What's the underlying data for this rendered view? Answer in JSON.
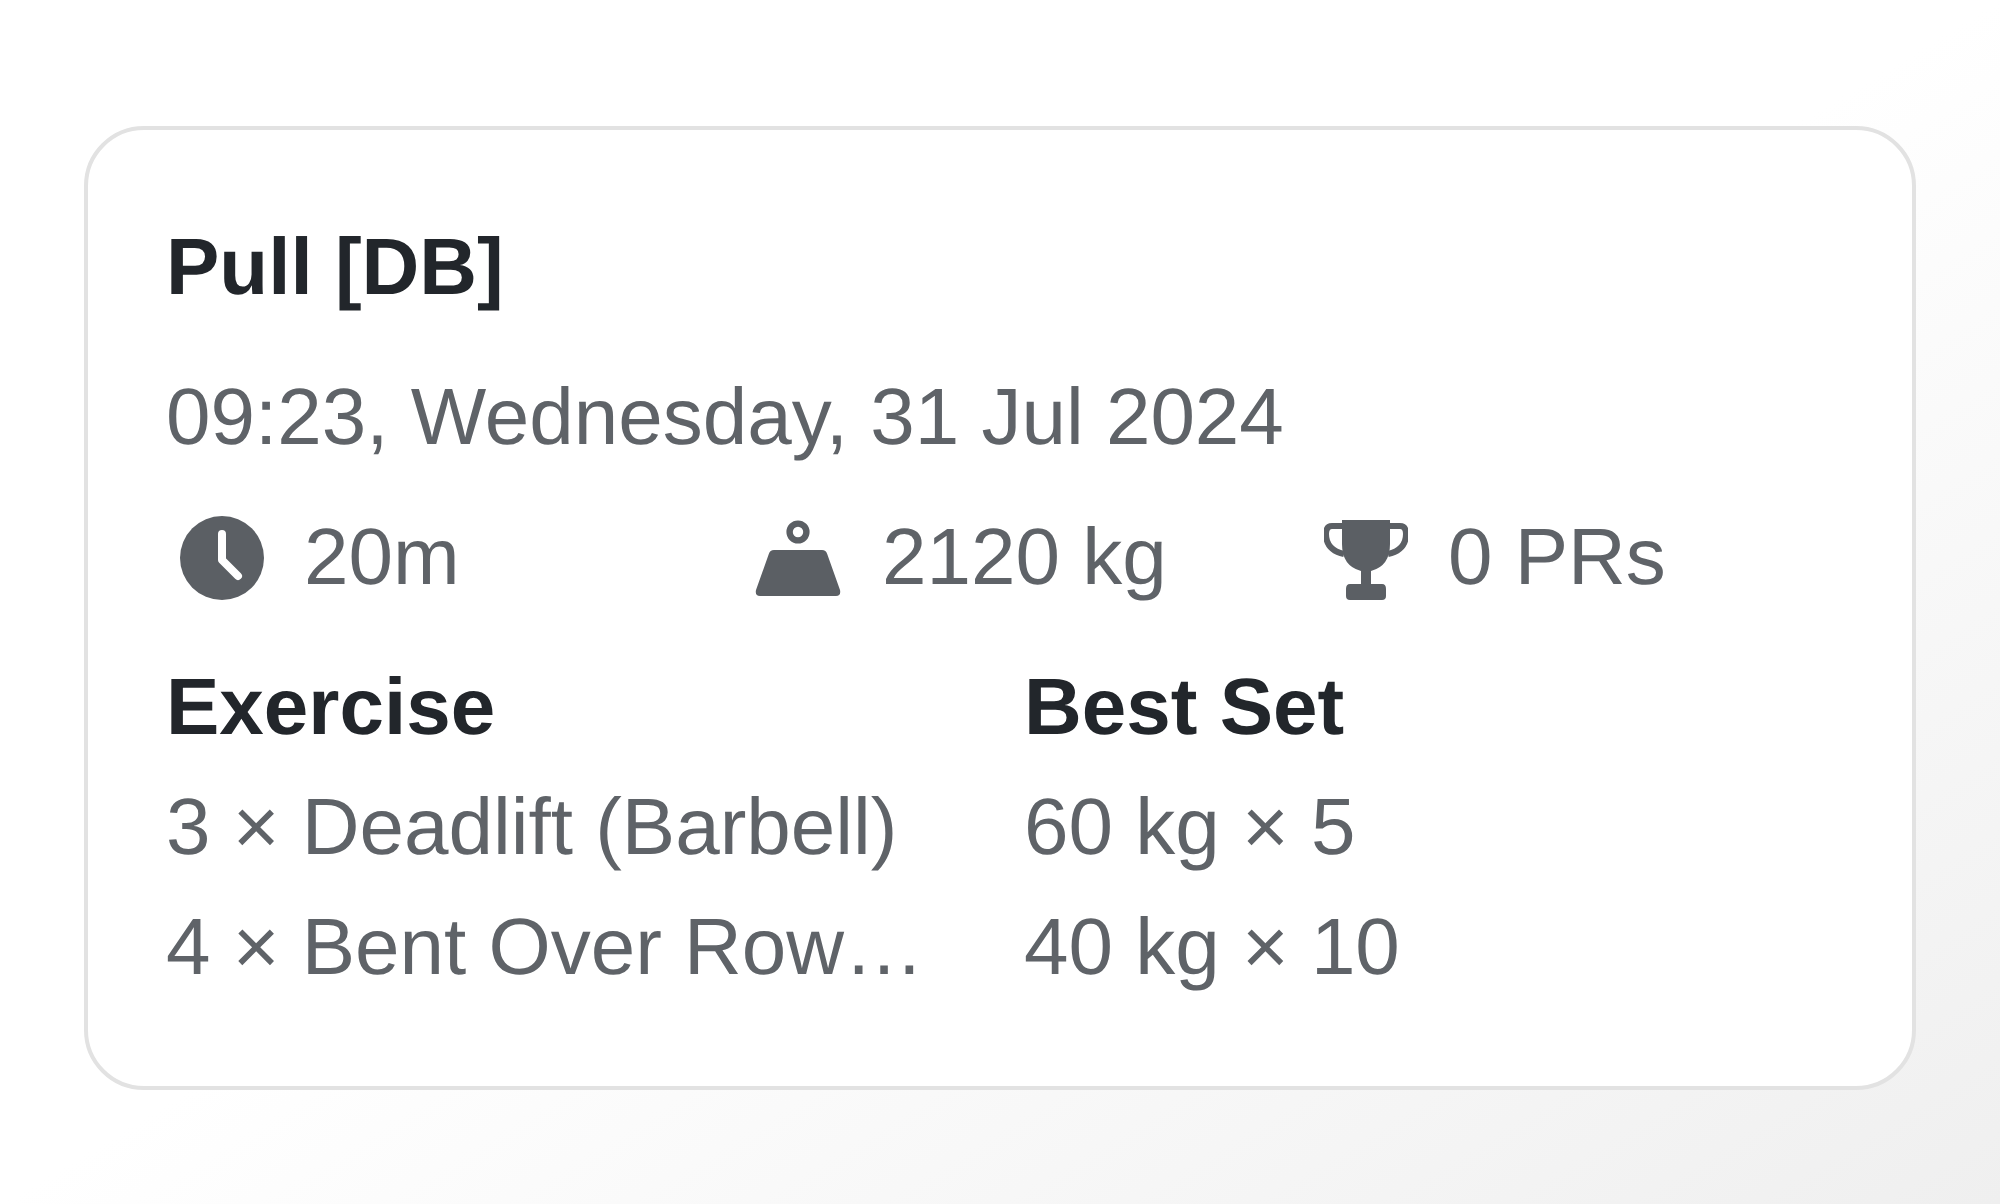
{
  "workout": {
    "title": "Pull [DB]",
    "datetime": "09:23, Wednesday, 31 Jul 2024",
    "stats": [
      {
        "kind": "duration",
        "value": "20m"
      },
      {
        "kind": "volume",
        "value": "2120 kg"
      },
      {
        "kind": "records",
        "value": "0 PRs"
      }
    ],
    "table": {
      "columns": [
        "Exercise",
        "Best Set"
      ],
      "rows": [
        [
          "3 × Deadlift (Barbell)",
          "60 kg × 5"
        ],
        [
          "4 × Bent Over Row…",
          "40 kg × 10"
        ]
      ]
    }
  }
}
